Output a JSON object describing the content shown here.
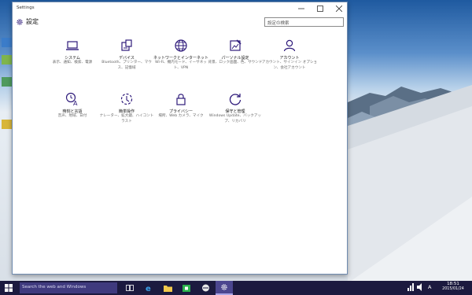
{
  "window": {
    "title": "Settings",
    "minimize_icon": "minimize-icon",
    "maximize_icon": "maximize-icon",
    "close_icon": "close-icon"
  },
  "header": {
    "title": "設定",
    "icon": "gear-icon",
    "search_placeholder": "設定の検索"
  },
  "categories": [
    {
      "id": "system",
      "icon": "laptop-icon",
      "title": "システム",
      "desc": "表示、通知、検索、電源"
    },
    {
      "id": "devices",
      "icon": "devices-icon",
      "title": "デバイス",
      "desc": "Bluetooth、プリンター、マウス、記憶域"
    },
    {
      "id": "network",
      "icon": "globe-icon",
      "title": "ネットワークとインターネット",
      "desc": "Wi-Fi、機内モード、イーサネット、VPN"
    },
    {
      "id": "personalization",
      "icon": "paint-icon",
      "title": "パーソナル設定",
      "desc": "背景、ロック画面、色、サウンド"
    },
    {
      "id": "accounts",
      "icon": "person-icon",
      "title": "アカウント",
      "desc": "アカウント、サインイン オプション、会社アカウント"
    },
    {
      "id": "time",
      "icon": "clock-language-icon",
      "title": "時刻と言語",
      "desc": "音声、地域、日付"
    },
    {
      "id": "ease",
      "icon": "ease-of-access-icon",
      "title": "簡単操作",
      "desc": "ナレーター、拡大鏡、ハイコントラスト"
    },
    {
      "id": "privacy",
      "icon": "lock-icon",
      "title": "プライバシー",
      "desc": "場所、Web カメラ、マイク"
    },
    {
      "id": "update",
      "icon": "update-icon",
      "title": "保守と管理",
      "desc": "Windows Update、バックアップ、リカバリ"
    }
  ],
  "taskbar": {
    "search_placeholder": "Search the web and Windows",
    "time": "18:51",
    "date": "2015/01/24",
    "ime": "A"
  },
  "colors": {
    "accent": "#2e1a7a",
    "taskbar": "#1c1a3f",
    "taskbar_search": "#3f3a7e"
  }
}
